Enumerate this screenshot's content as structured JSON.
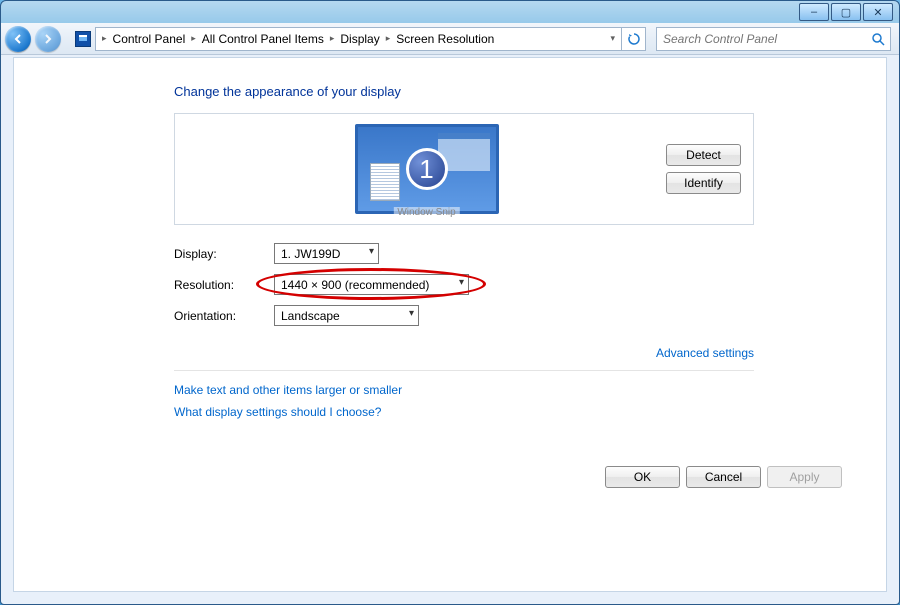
{
  "titlebar": {
    "minimize": "–",
    "maximize": "▢",
    "close": "✕"
  },
  "nav": {
    "back_glyph": "◀",
    "forward_glyph": "▶"
  },
  "breadcrumb": {
    "items": [
      "Control Panel",
      "All Control Panel Items",
      "Display",
      "Screen Resolution"
    ],
    "sep": "▸",
    "drop": "▾",
    "refresh": "↻"
  },
  "search": {
    "placeholder": "Search Control Panel",
    "icon": "🔍"
  },
  "heading": "Change the appearance of your display",
  "preview": {
    "monitor_number": "1",
    "caption": "Window Snip",
    "detect": "Detect",
    "identify": "Identify"
  },
  "form": {
    "display_label": "Display:",
    "display_value": "1. JW199D",
    "resolution_label": "Resolution:",
    "resolution_value": "1440 × 900 (recommended)",
    "orientation_label": "Orientation:",
    "orientation_value": "Landscape"
  },
  "links": {
    "advanced": "Advanced settings",
    "larger": "Make text and other items larger or smaller",
    "help": "What display settings should I choose?"
  },
  "actions": {
    "ok": "OK",
    "cancel": "Cancel",
    "apply": "Apply"
  }
}
